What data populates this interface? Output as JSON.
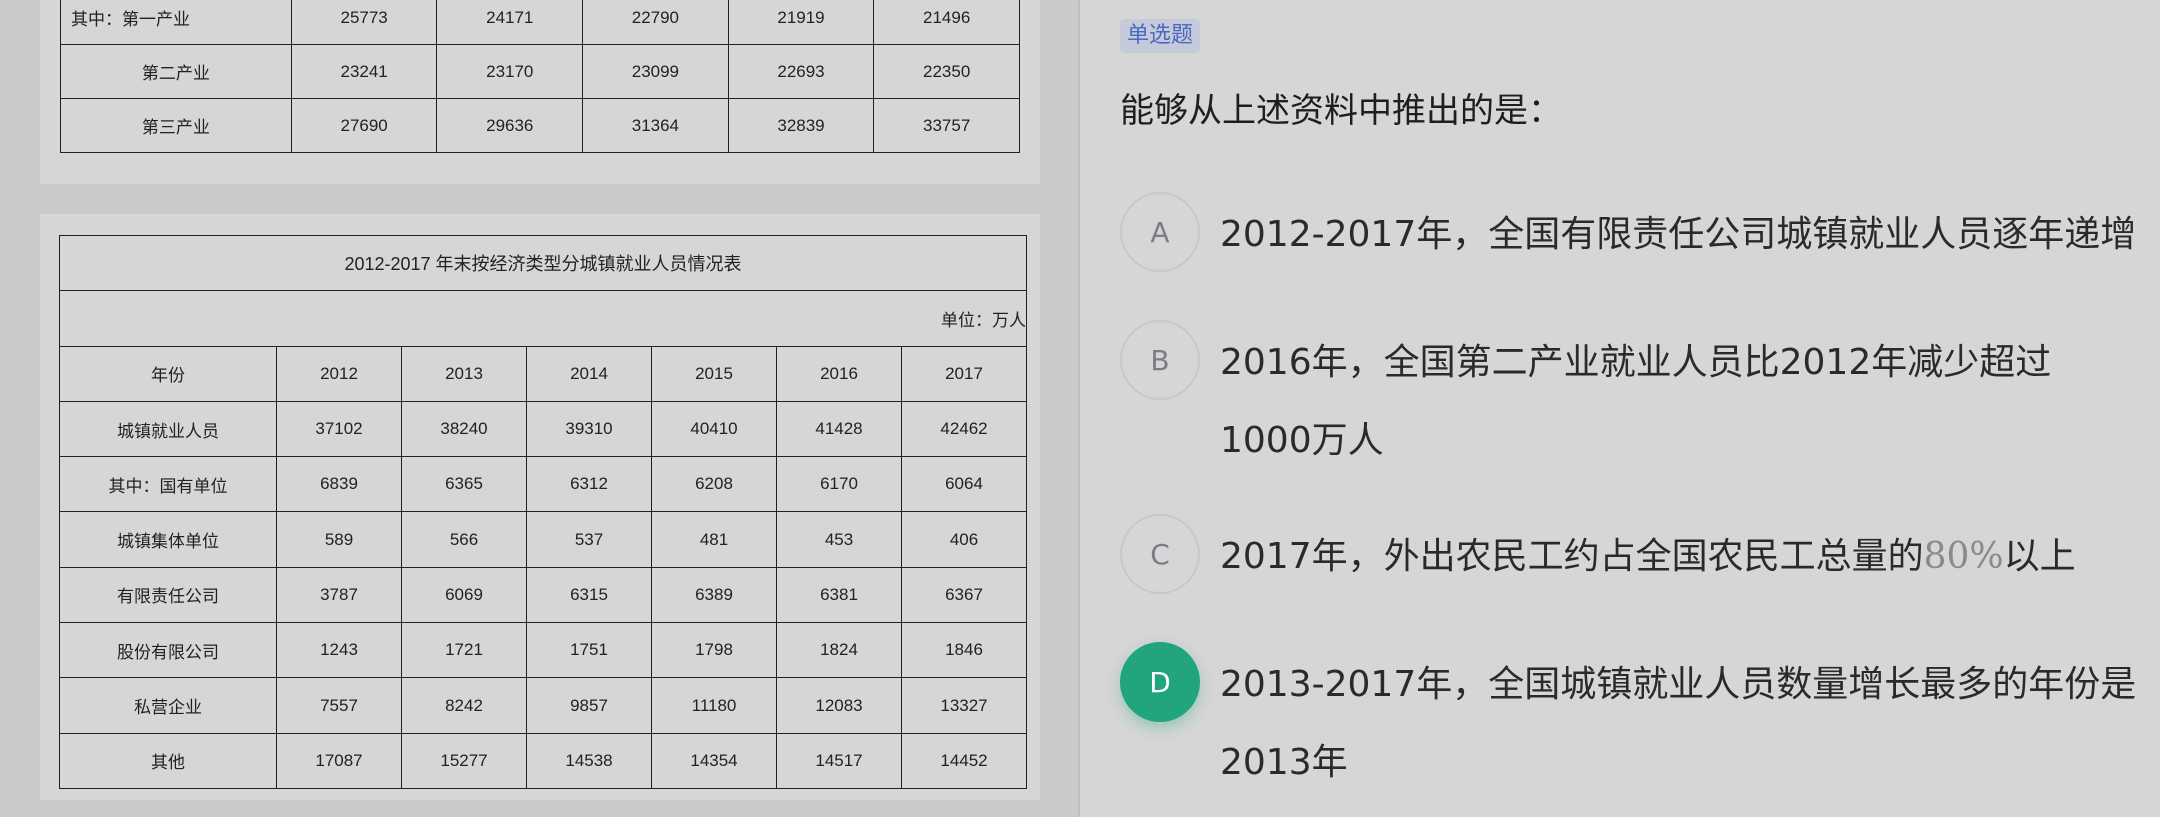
{
  "table1": {
    "rows": [
      {
        "label": "其中：第一产业",
        "values": [
          "25773",
          "24171",
          "22790",
          "21919",
          "21496"
        ]
      },
      {
        "label": "第二产业",
        "values": [
          "23241",
          "23170",
          "23099",
          "22693",
          "22350"
        ]
      },
      {
        "label": "第三产业",
        "values": [
          "27690",
          "29636",
          "31364",
          "32839",
          "33757"
        ]
      }
    ]
  },
  "table2": {
    "title": "2012-2017 年末按经济类型分城镇就业人员情况表",
    "unit": "单位：万人",
    "header": {
      "label": "年份",
      "years": [
        "2012",
        "2013",
        "2014",
        "2015",
        "2016",
        "2017"
      ]
    },
    "rows": [
      {
        "label": "城镇就业人员",
        "values": [
          "37102",
          "38240",
          "39310",
          "40410",
          "41428",
          "42462"
        ]
      },
      {
        "label": "其中：国有单位",
        "values": [
          "6839",
          "6365",
          "6312",
          "6208",
          "6170",
          "6064"
        ]
      },
      {
        "label": "城镇集体单位",
        "values": [
          "589",
          "566",
          "537",
          "481",
          "453",
          "406"
        ]
      },
      {
        "label": "有限责任公司",
        "values": [
          "3787",
          "6069",
          "6315",
          "6389",
          "6381",
          "6367"
        ]
      },
      {
        "label": "股份有限公司",
        "values": [
          "1243",
          "1721",
          "1751",
          "1798",
          "1824",
          "1846"
        ]
      },
      {
        "label": "私营企业",
        "values": [
          "7557",
          "8242",
          "9857",
          "11180",
          "12083",
          "13327"
        ]
      },
      {
        "label": "其他",
        "values": [
          "17087",
          "15277",
          "14538",
          "14354",
          "14517",
          "14452"
        ]
      }
    ]
  },
  "question": {
    "type_badge": "单选题",
    "stem": "能够从上述资料中推出的是：",
    "options": [
      {
        "letter": "A",
        "text": "2012-2017年，全国有限责任公司城镇就业人员逐年递增"
      },
      {
        "letter": "B",
        "text": "2016年，全国第二产业就业人员比2012年减少超过1000万人"
      },
      {
        "letter": "C",
        "text_before": "2017年，外出农民工约占全国农民工总量的",
        "text_pct": "80%",
        "text_after": "以上"
      },
      {
        "letter": "D",
        "text": "2013-2017年，全国城镇就业人员数量增长最多的年份是2013年"
      }
    ],
    "selected": "D",
    "selected_color": "#22a57f",
    "badge_color": "#4a68c2"
  }
}
